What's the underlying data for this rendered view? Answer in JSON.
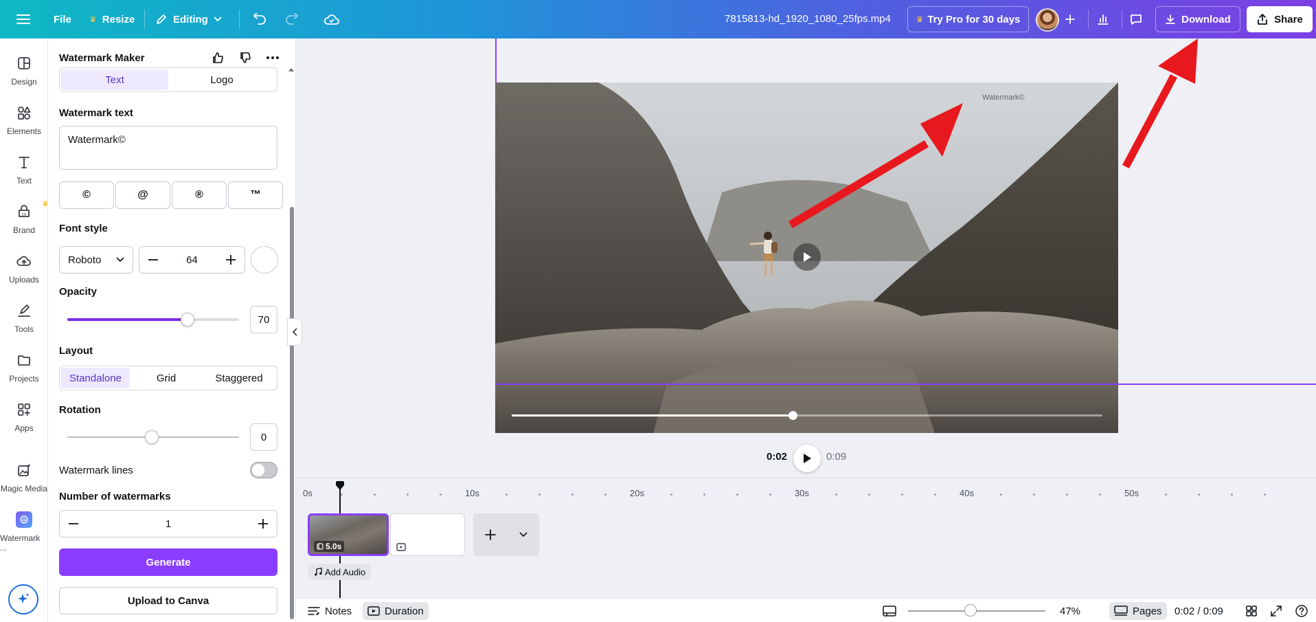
{
  "topbar": {
    "file_label": "File",
    "resize_label": "Resize",
    "editing_label": "Editing",
    "filename": "7815813-hd_1920_1080_25fps.mp4",
    "try_pro_label": "Try Pro for 30 days",
    "download_label": "Download",
    "share_label": "Share"
  },
  "rail": {
    "items": [
      {
        "label": "Design",
        "icon": "layout-icon"
      },
      {
        "label": "Elements",
        "icon": "shapes-icon"
      },
      {
        "label": "Text",
        "icon": "text-icon"
      },
      {
        "label": "Brand",
        "icon": "brand-icon"
      },
      {
        "label": "Uploads",
        "icon": "cloud-upload-icon"
      },
      {
        "label": "Tools",
        "icon": "pen-icon"
      },
      {
        "label": "Projects",
        "icon": "folder-icon"
      },
      {
        "label": "Apps",
        "icon": "apps-icon"
      },
      {
        "label": "Magic Media",
        "icon": "magic-media-icon"
      },
      {
        "label": "Watermark ...",
        "icon": "watermark-app-icon"
      }
    ]
  },
  "panel": {
    "title": "Watermark Maker",
    "mode_tabs": [
      "Text",
      "Logo"
    ],
    "watermark_text_label": "Watermark text",
    "watermark_text_value": "Watermark©",
    "symbols": [
      "©",
      "@",
      "®",
      "™"
    ],
    "font_style_label": "Font style",
    "font_family": "Roboto",
    "font_size": "64",
    "opacity_label": "Opacity",
    "opacity_value": "70",
    "layout_label": "Layout",
    "layout_options": [
      "Standalone",
      "Grid",
      "Staggered"
    ],
    "rotation_label": "Rotation",
    "rotation_value": "0",
    "watermark_lines_label": "Watermark lines",
    "watermark_lines_on": false,
    "number_label": "Number of watermarks",
    "number_value": "1",
    "generate_label": "Generate",
    "upload_label": "Upload to Canva"
  },
  "canvas": {
    "watermark_preview": "Watermark©",
    "playback_progress": 0.475
  },
  "player": {
    "current_time": "0:02",
    "total_time": "0:09"
  },
  "timeline": {
    "ticks": [
      "0s",
      "10s",
      "20s",
      "30s",
      "40s",
      "50s"
    ],
    "clip_duration": "5.0s",
    "add_audio_label": "Add Audio"
  },
  "bottombar": {
    "notes_label": "Notes",
    "duration_label": "Duration",
    "zoom_value": "47%",
    "pages_label": "Pages",
    "time_readout": "0:02 / 0:09"
  },
  "colors": {
    "accent": "#8b3dff",
    "annotation_arrow": "#e8191e"
  }
}
